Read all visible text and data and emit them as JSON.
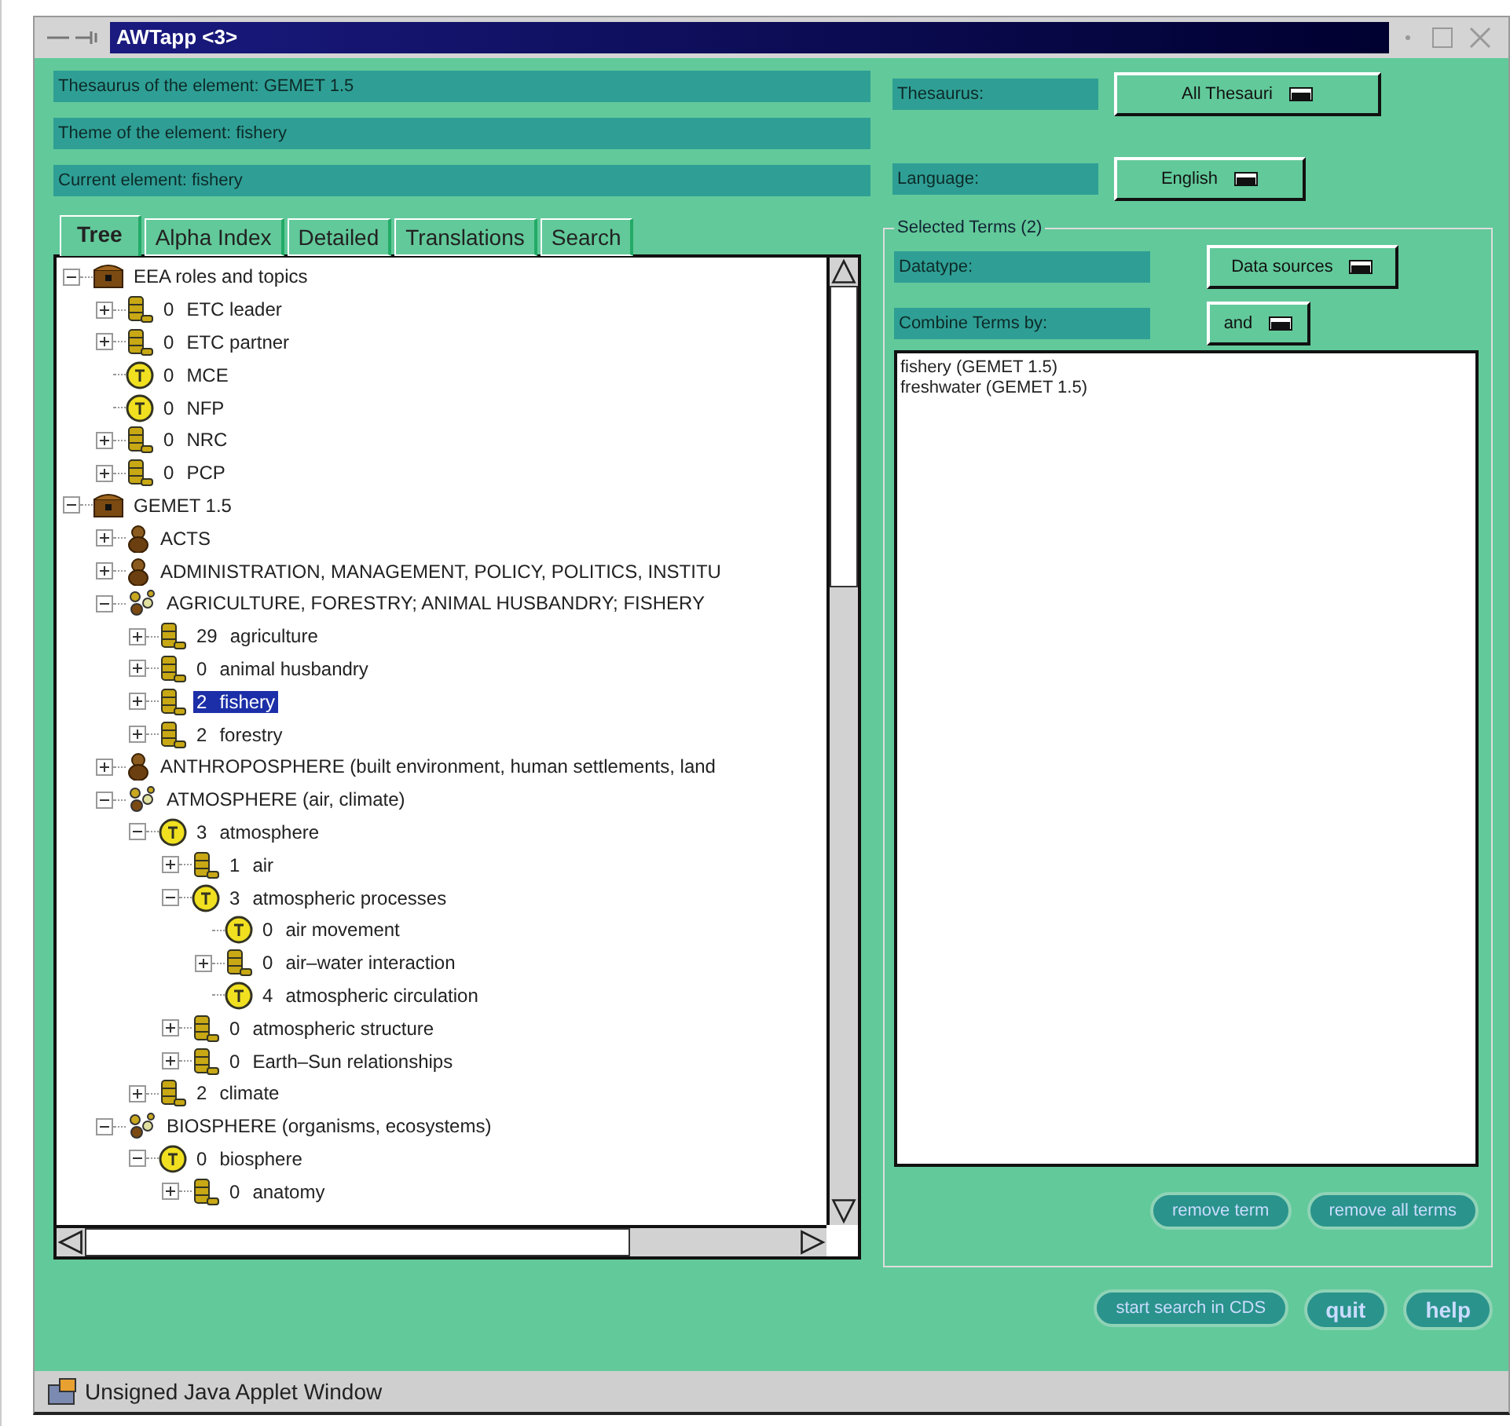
{
  "window": {
    "title": "AWTapp <3>"
  },
  "info": [
    "Thesaurus of the element: GEMET 1.5",
    "Theme of the element: fishery",
    "Current element:  fishery"
  ],
  "thesaurus": {
    "label": "Thesaurus:",
    "value": "All Thesauri"
  },
  "language": {
    "label": "Language:",
    "value": "English"
  },
  "tabs": [
    {
      "label": "Tree",
      "selected": true
    },
    {
      "label": "Alpha Index",
      "selected": false
    },
    {
      "label": "Detailed",
      "selected": false
    },
    {
      "label": "Translations",
      "selected": false
    },
    {
      "label": "Search",
      "selected": false
    }
  ],
  "tree": [
    {
      "kind": "chest",
      "label": "EEA roles and topics",
      "expanded": true,
      "selected": false,
      "children": [
        {
          "kind": "book",
          "count": "0",
          "label": "ETC leader",
          "expanded": false,
          "selected": false
        },
        {
          "kind": "book",
          "count": "0",
          "label": "ETC partner",
          "expanded": false,
          "selected": false
        },
        {
          "kind": "coin",
          "count": "0",
          "label": "MCE",
          "selected": false
        },
        {
          "kind": "coin",
          "count": "0",
          "label": "NFP",
          "selected": false
        },
        {
          "kind": "book",
          "count": "0",
          "label": "NRC",
          "expanded": false,
          "selected": false
        },
        {
          "kind": "book",
          "count": "0",
          "label": "PCP",
          "expanded": false,
          "selected": false
        }
      ]
    },
    {
      "kind": "chest",
      "label": "GEMET 1.5",
      "expanded": true,
      "selected": false,
      "children": [
        {
          "kind": "figure",
          "label": "ACTS",
          "expanded": false,
          "selected": false
        },
        {
          "kind": "figure",
          "label": "ADMINISTRATION, MANAGEMENT, POLICY, POLITICS, INSTITU",
          "expanded": false,
          "selected": false
        },
        {
          "kind": "group",
          "label": "AGRICULTURE, FORESTRY; ANIMAL HUSBANDRY; FISHERY",
          "expanded": true,
          "selected": false,
          "children": [
            {
              "kind": "book",
              "count": "29",
              "label": "agriculture",
              "expanded": false,
              "selected": false
            },
            {
              "kind": "book",
              "count": "0",
              "label": "animal husbandry",
              "expanded": false,
              "selected": false
            },
            {
              "kind": "book",
              "count": "2",
              "label": "fishery",
              "expanded": false,
              "selected": true
            },
            {
              "kind": "book",
              "count": "2",
              "label": "forestry",
              "expanded": false,
              "selected": false
            }
          ]
        },
        {
          "kind": "figure",
          "label": "ANTHROPOSPHERE (built environment, human settlements, land",
          "expanded": false,
          "selected": false
        },
        {
          "kind": "group",
          "label": "ATMOSPHERE (air, climate)",
          "expanded": true,
          "selected": false,
          "children": [
            {
              "kind": "coin",
              "count": "3",
              "label": "atmosphere",
              "expanded": true,
              "selected": false,
              "children": [
                {
                  "kind": "book",
                  "count": "1",
                  "label": "air",
                  "expanded": false,
                  "selected": false
                },
                {
                  "kind": "coin",
                  "count": "3",
                  "label": "atmospheric processes",
                  "expanded": true,
                  "selected": false,
                  "children": [
                    {
                      "kind": "coin",
                      "count": "0",
                      "label": "air movement",
                      "selected": false
                    },
                    {
                      "kind": "book",
                      "count": "0",
                      "label": "air–water interaction",
                      "expanded": false,
                      "selected": false
                    },
                    {
                      "kind": "coin",
                      "count": "4",
                      "label": "atmospheric circulation",
                      "selected": false
                    }
                  ]
                },
                {
                  "kind": "book",
                  "count": "0",
                  "label": "atmospheric structure",
                  "expanded": false,
                  "selected": false
                },
                {
                  "kind": "book",
                  "count": "0",
                  "label": "Earth–Sun relationships",
                  "expanded": false,
                  "selected": false
                }
              ]
            },
            {
              "kind": "book",
              "count": "2",
              "label": "climate",
              "expanded": false,
              "selected": false
            }
          ]
        },
        {
          "kind": "group",
          "label": "BIOSPHERE (organisms, ecosystems)",
          "expanded": true,
          "selected": false,
          "children": [
            {
              "kind": "coin",
              "count": "0",
              "label": "biosphere",
              "expanded": true,
              "selected": false,
              "children": [
                {
                  "kind": "book",
                  "count": "0",
                  "label": "anatomy",
                  "expanded": false,
                  "selected": false
                }
              ]
            }
          ]
        }
      ]
    }
  ],
  "selected_terms": {
    "title": "Selected Terms (2)",
    "datatype": {
      "label": "Datatype:",
      "value": "Data sources"
    },
    "combine": {
      "label": "Combine Terms by:",
      "value": "and"
    },
    "terms": [
      "fishery (GEMET 1.5)",
      "freshwater (GEMET 1.5)"
    ],
    "buttons": [
      "remove term",
      "remove all terms"
    ]
  },
  "buttons": [
    "start search in CDS",
    "quit",
    "help"
  ],
  "status_bar": "Unsigned Java Applet Window"
}
